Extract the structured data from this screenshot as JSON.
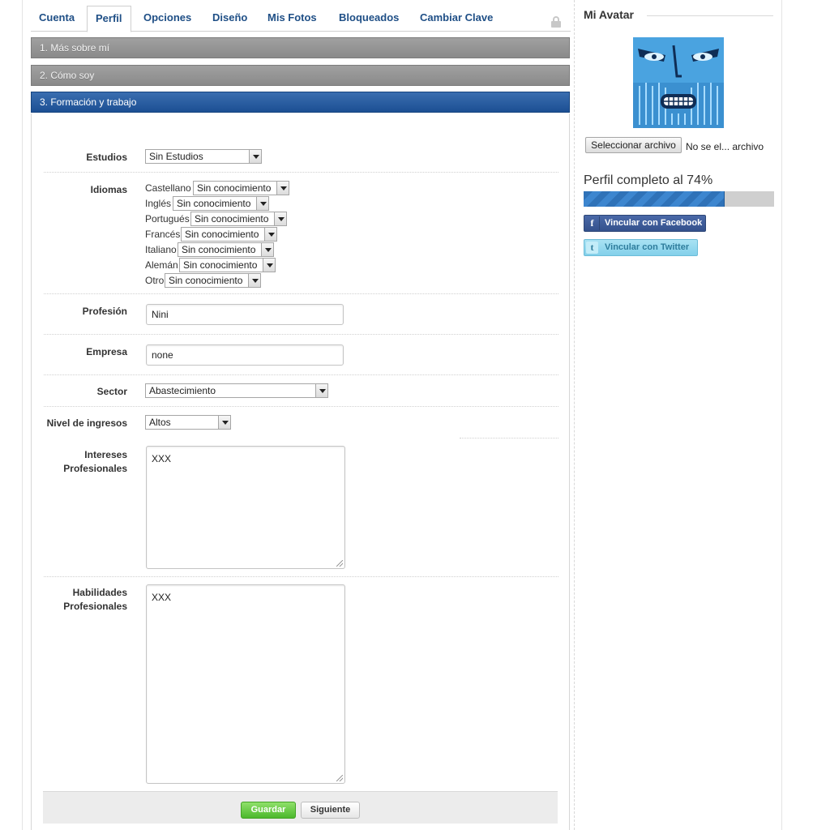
{
  "tabs": [
    {
      "label": "Cuenta"
    },
    {
      "label": "Perfil"
    },
    {
      "label": "Opciones"
    },
    {
      "label": "Diseño"
    },
    {
      "label": "Mis Fotos"
    },
    {
      "label": "Bloqueados"
    },
    {
      "label": "Cambiar Clave"
    }
  ],
  "accordion": {
    "section1": "1. Más sobre mí",
    "section2": "2. Cómo soy",
    "section3": "3. Formación y trabajo"
  },
  "form": {
    "estudios": {
      "label": "Estudios",
      "value": "Sin Estudios"
    },
    "idiomas": {
      "label": "Idiomas",
      "items": [
        {
          "lang": "Castellano",
          "value": "Sin conocimiento"
        },
        {
          "lang": "Inglés",
          "value": "Sin conocimiento"
        },
        {
          "lang": "Portugués",
          "value": "Sin conocimiento"
        },
        {
          "lang": "Francés",
          "value": "Sin conocimiento"
        },
        {
          "lang": "Italiano",
          "value": "Sin conocimiento"
        },
        {
          "lang": "Alemán",
          "value": "Sin conocimiento"
        },
        {
          "lang": "Otro",
          "value": "Sin conocimiento"
        }
      ]
    },
    "profesion": {
      "label": "Profesión",
      "value": "Nini"
    },
    "empresa": {
      "label": "Empresa",
      "value": "none"
    },
    "sector": {
      "label": "Sector",
      "value": "Abastecimiento"
    },
    "ingresos": {
      "label": "Nivel de ingresos",
      "value": "Altos"
    },
    "intereses": {
      "label_line1": "Intereses",
      "label_line2": "Profesionales",
      "value": "XXX"
    },
    "habilidades": {
      "label_line1": "Habilidades",
      "label_line2": "Profesionales",
      "value": "XXX"
    },
    "save_label": "Guardar",
    "next_label": "Siguiente"
  },
  "sidebar": {
    "title": "Mi Avatar",
    "file_button": "Seleccionar archivo",
    "file_status": "No se el... archivo",
    "profile_complete": "Perfil completo al 74%",
    "profile_complete_fraction": 0.74,
    "facebook_label": "Vincular con Facebook",
    "twitter_label": "Vincular con Twitter"
  },
  "colors": {
    "tab_text": "#1f4f86",
    "accordion_active": "#1c4f93",
    "accordion_inactive": "#8a8a8a",
    "save_button": "#4cb82c",
    "progress": "#2f72b8",
    "facebook": "#3b5998",
    "twitter": "#83d0ea"
  }
}
